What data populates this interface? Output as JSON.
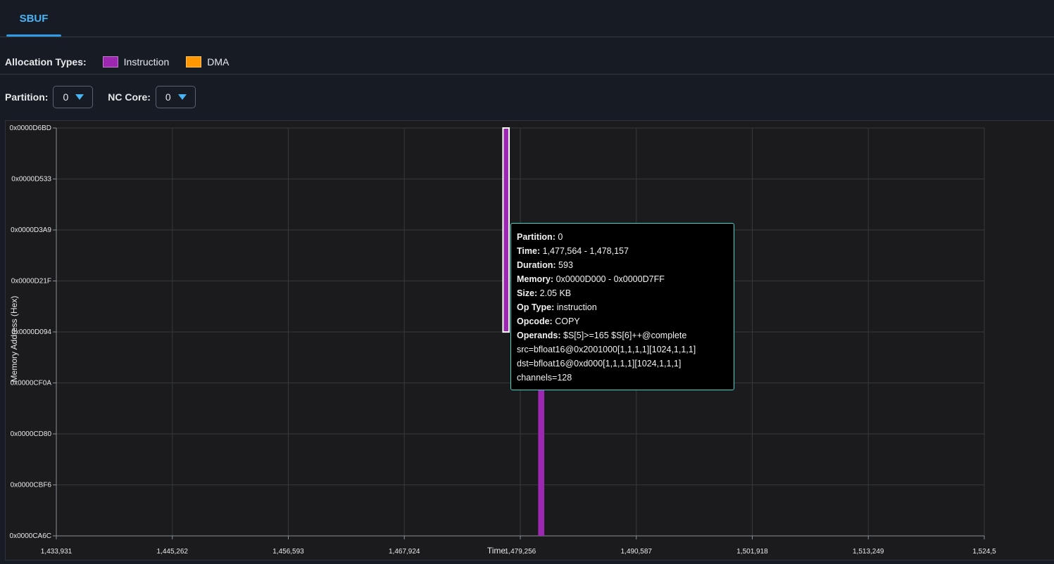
{
  "tabs": [
    {
      "label": "SBUF",
      "active": true
    }
  ],
  "legend": {
    "title": "Allocation Types:",
    "items": [
      {
        "label": "Instruction",
        "color": "#9c27b0"
      },
      {
        "label": "DMA",
        "color": "#ff9800"
      }
    ]
  },
  "controls": {
    "partition": {
      "label": "Partition:",
      "value": "0"
    },
    "nc_core": {
      "label": "NC Core:",
      "value": "0"
    }
  },
  "chart_data": {
    "type": "timeline",
    "xlabel": "Time",
    "ylabel": "Memory Address (Hex)",
    "x_ticks": [
      "1,433,931",
      "1,445,262",
      "1,456,593",
      "1,467,924",
      "1,479,256",
      "1,490,587",
      "1,501,918",
      "1,513,249",
      "1,524,5"
    ],
    "y_ticks": [
      "0x0000D6BD",
      "0x0000D533",
      "0x0000D3A9",
      "0x0000D21F",
      "0x0000D094",
      "0x0000CF0A",
      "0x0000CD80",
      "0x0000CBF6",
      "0x0000CA6C"
    ],
    "grid": true,
    "bars": [
      {
        "type": "instruction",
        "time_start": 1477564,
        "time_end": 1478157,
        "addr_from": "0x0000D094",
        "addr_to": "0x0000D6BD",
        "color": "#9c27b0",
        "highlighted": true
      },
      {
        "type": "instruction",
        "time_start": 1481000,
        "time_end": 1481600,
        "addr_from": "0x0000CA6C",
        "addr_to": "0x0000CF0A",
        "color": "#9c27b0",
        "highlighted": false
      }
    ]
  },
  "tooltip": {
    "partition": {
      "label": "Partition:",
      "value": "0"
    },
    "time": {
      "label": "Time:",
      "value": "1,477,564 - 1,478,157"
    },
    "duration": {
      "label": "Duration:",
      "value": "593"
    },
    "memory": {
      "label": "Memory:",
      "value": "0x0000D000 - 0x0000D7FF"
    },
    "size": {
      "label": "Size:",
      "value": "2.05 KB"
    },
    "op_type": {
      "label": "Op Type:",
      "value": "instruction"
    },
    "opcode": {
      "label": "Opcode:",
      "value": "COPY"
    },
    "operands": {
      "label": "Operands:",
      "value": "$S[5]>=165 $S[6]++@complete"
    },
    "src": "src=bfloat16@0x2001000[1,1,1,1][1024,1,1,1]",
    "dst": "dst=bfloat16@0xd000[1,1,1,1][1024,1,1,1]",
    "channels": "channels=128"
  }
}
